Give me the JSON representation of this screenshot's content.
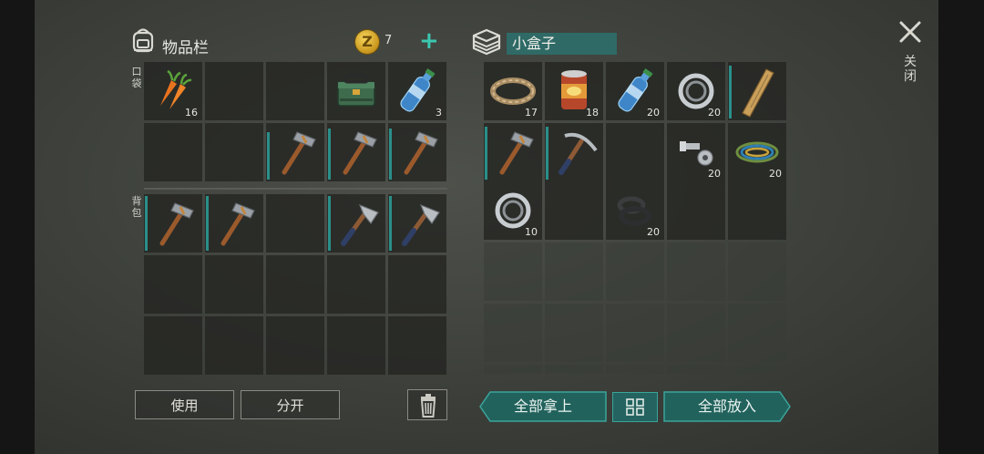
{
  "player_inventory": {
    "title": "物品栏",
    "coins": "7",
    "pockets_label": "口袋",
    "backpack_label": "背包",
    "pockets": [
      {
        "icon": "carrot-icon",
        "qty": "16"
      },
      {
        "icon": "empty-slot",
        "qty": ""
      },
      {
        "icon": "empty-slot",
        "qty": ""
      },
      {
        "icon": "toolbox-icon",
        "qty": ""
      },
      {
        "icon": "water-bottle-icon",
        "qty": "3"
      },
      {
        "icon": "empty-slot",
        "qty": ""
      },
      {
        "icon": "empty-slot",
        "qty": ""
      },
      {
        "icon": "stone-hammer-icon",
        "qty": ""
      },
      {
        "icon": "stone-hammer-icon",
        "qty": ""
      },
      {
        "icon": "stone-hammer-icon",
        "qty": ""
      }
    ],
    "backpack": [
      {
        "icon": "stone-hammer-icon",
        "qty": ""
      },
      {
        "icon": "stone-hammer-icon",
        "qty": ""
      },
      {
        "icon": "empty-slot",
        "qty": ""
      },
      {
        "icon": "hatchet-icon",
        "qty": ""
      },
      {
        "icon": "hatchet-icon",
        "qty": ""
      },
      {
        "icon": "empty-slot",
        "qty": ""
      },
      {
        "icon": "empty-slot",
        "qty": ""
      },
      {
        "icon": "empty-slot",
        "qty": ""
      },
      {
        "icon": "empty-slot",
        "qty": ""
      },
      {
        "icon": "empty-slot",
        "qty": ""
      },
      {
        "icon": "empty-slot",
        "qty": ""
      },
      {
        "icon": "empty-slot",
        "qty": ""
      },
      {
        "icon": "empty-slot",
        "qty": ""
      },
      {
        "icon": "empty-slot",
        "qty": ""
      },
      {
        "icon": "empty-slot",
        "qty": ""
      }
    ]
  },
  "container": {
    "name": "小盒子",
    "close_label": "关闭",
    "slots": [
      {
        "icon": "rope-icon",
        "qty": "17"
      },
      {
        "icon": "canned-food-icon",
        "qty": "18"
      },
      {
        "icon": "water-bottle-icon",
        "qty": "20"
      },
      {
        "icon": "bearing-icon",
        "qty": "20"
      },
      {
        "icon": "wooden-plank-icon",
        "qty": ""
      },
      {
        "icon": "stone-hammer-icon",
        "qty": ""
      },
      {
        "icon": "pickaxe-icon",
        "qty": ""
      },
      {
        "icon": "empty-slot",
        "qty": ""
      },
      {
        "icon": "bolt-nut-icon",
        "qty": "20"
      },
      {
        "icon": "wire-coil-icon",
        "qty": "20"
      },
      {
        "icon": "bearing-icon",
        "qty": "10"
      },
      {
        "icon": "empty-slot",
        "qty": ""
      },
      {
        "icon": "rubber-seal-icon",
        "qty": "20"
      },
      {
        "icon": "empty-slot",
        "qty": ""
      },
      {
        "icon": "empty-slot",
        "qty": ""
      }
    ]
  },
  "buttons": {
    "use": "使用",
    "split": "分开",
    "take_all": "全部拿上",
    "put_all": "全部放入"
  },
  "colors": {
    "accent": "#2f8f87",
    "bar": "#2a8f8a",
    "coin": "#e0b23a"
  }
}
